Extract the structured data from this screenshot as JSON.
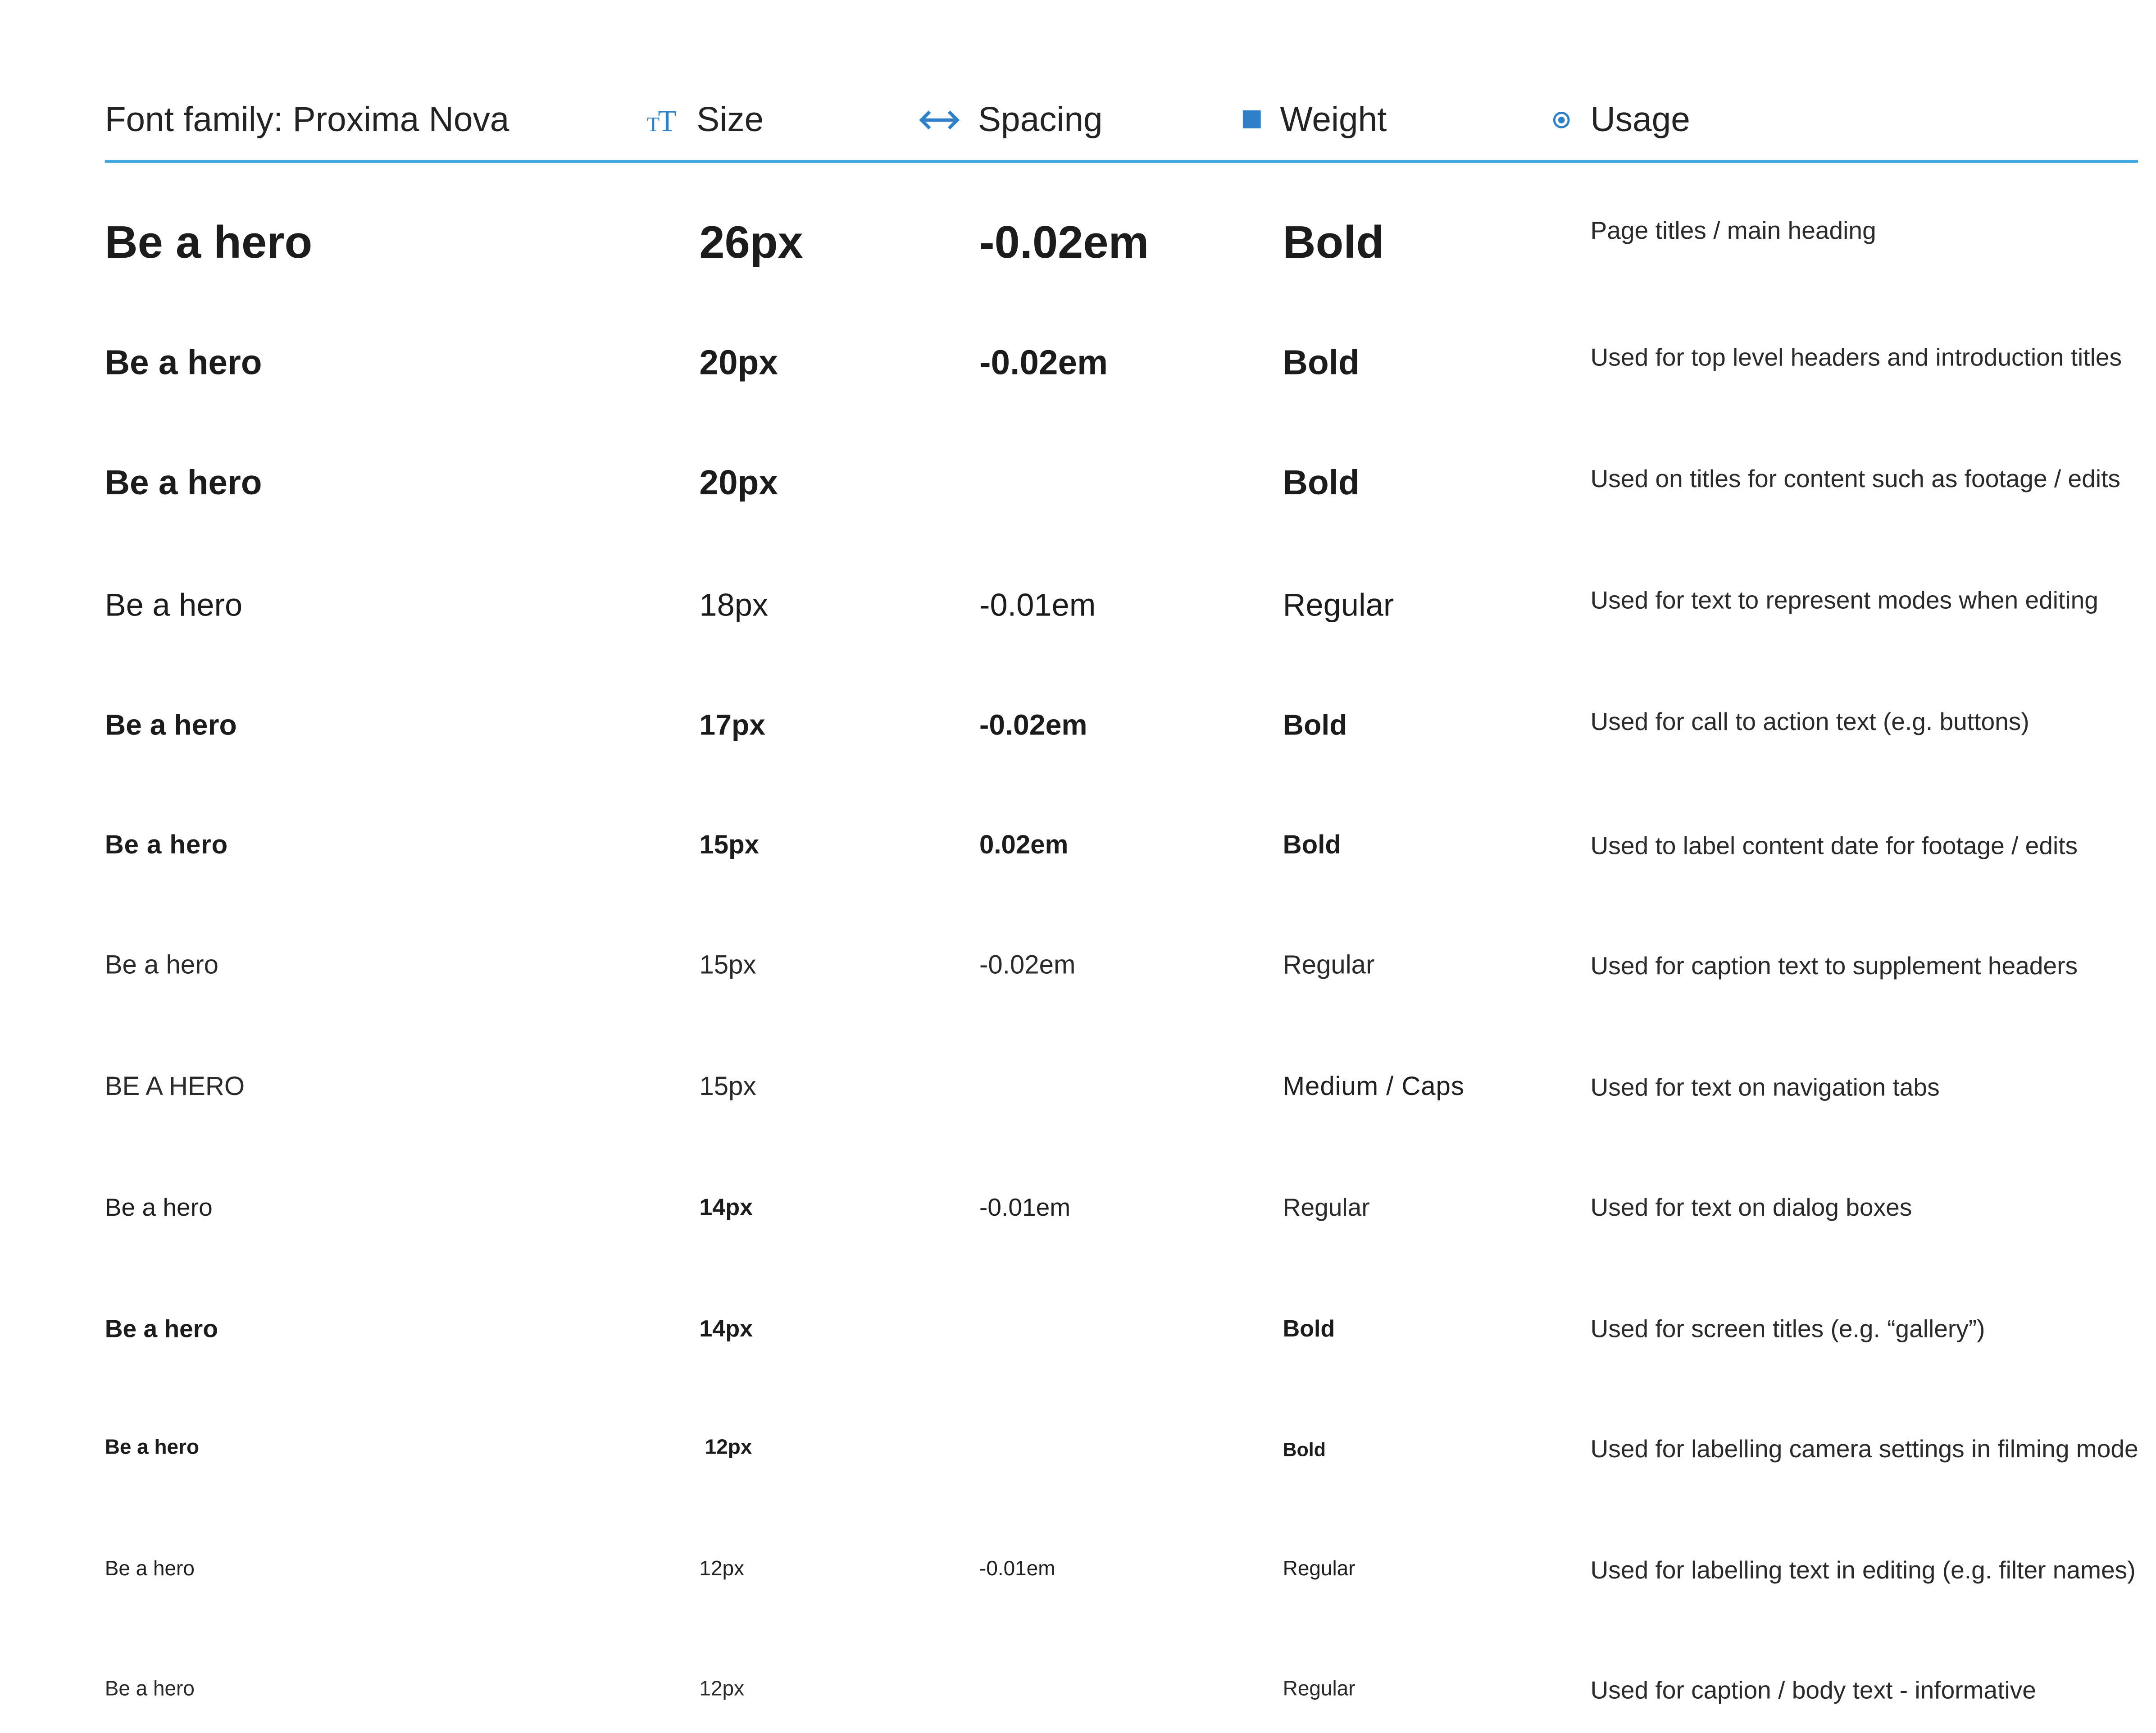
{
  "header": {
    "font_family_label": "Font family: Proxima Nova",
    "columns": {
      "size": "Size",
      "spacing": "Spacing",
      "weight": "Weight",
      "usage": "Usage"
    },
    "icons": {
      "size": "text-size-icon",
      "spacing": "double-arrow-icon",
      "weight": "filled-square-icon",
      "usage": "target-dot-icon"
    },
    "accent_color": "#2f80c8",
    "rule_color": "#3aa6e0"
  },
  "rows": [
    {
      "sample": "Be a hero",
      "size": "26px",
      "spacing": "-0.02em",
      "weight": "Bold",
      "usage": "Page titles / main heading"
    },
    {
      "sample": "Be a hero",
      "size": "20px",
      "spacing": "-0.02em",
      "weight": "Bold",
      "usage": "Used for top level headers and introduction titles"
    },
    {
      "sample": "Be a hero",
      "size": "20px",
      "spacing": "",
      "weight": "Bold",
      "usage": "Used on titles for content such as footage / edits"
    },
    {
      "sample": "Be a hero",
      "size": "18px",
      "spacing": "-0.01em",
      "weight": "Regular",
      "usage": "Used for text to represent modes when editing"
    },
    {
      "sample": "Be a hero",
      "size": "17px",
      "spacing": "-0.02em",
      "weight": "Bold",
      "usage": "Used for call to action text (e.g. buttons)"
    },
    {
      "sample": "Be a hero",
      "size": "15px",
      "spacing": "0.02em",
      "weight": "Bold",
      "usage": "Used to label content date for footage / edits"
    },
    {
      "sample": "Be a hero",
      "size": "15px",
      "spacing": "-0.02em",
      "weight": "Regular",
      "usage": "Used for caption text to supplement headers"
    },
    {
      "sample": "BE A HERO",
      "size": "15px",
      "spacing": "",
      "weight": "Medium / Caps",
      "usage": "Used for text on navigation tabs"
    },
    {
      "sample": "Be a hero",
      "size": "14px",
      "spacing": "-0.01em",
      "weight": "Regular",
      "usage": "Used for text on dialog boxes"
    },
    {
      "sample": "Be a hero",
      "size": "14px",
      "spacing": "",
      "weight": "Bold",
      "usage": "Used for screen titles (e.g. “gallery”)"
    },
    {
      "sample": "Be a hero",
      "size": "12px",
      "spacing": "",
      "weight": "Bold",
      "usage": "Used for labelling camera settings in filming mode"
    },
    {
      "sample": "Be a hero",
      "size": "12px",
      "spacing": "-0.01em",
      "weight": "Regular",
      "usage": "Used for labelling text in editing (e.g. filter names)"
    },
    {
      "sample": "Be a hero",
      "size": "12px",
      "spacing": "",
      "weight": "Regular",
      "usage": "Used for caption / body text - informative"
    }
  ]
}
